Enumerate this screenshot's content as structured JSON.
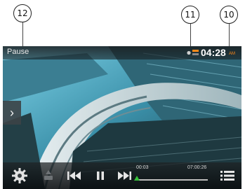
{
  "callouts": [
    {
      "number": "12",
      "target": "status-label"
    },
    {
      "number": "11",
      "target": "status-icons"
    },
    {
      "number": "10",
      "target": "clock"
    }
  ],
  "status_bar": {
    "playback_state": "Pause",
    "clock": {
      "time": "04:28",
      "ampm": "AM"
    }
  },
  "playback": {
    "elapsed": "00:03",
    "total": "07:00:26",
    "progress_fraction": 0.01
  },
  "icons": {
    "settings": "gear-icon",
    "subtitle": "subtitle-icon",
    "previous": "previous-track-icon",
    "pause": "pause-icon",
    "next": "next-track-icon",
    "menu": "list-menu-icon",
    "side_panel": "chevron-right-icon"
  },
  "colors": {
    "accent": "#2ea8e0",
    "knob": "#37c23a",
    "ampm": "#ff8a1a"
  }
}
